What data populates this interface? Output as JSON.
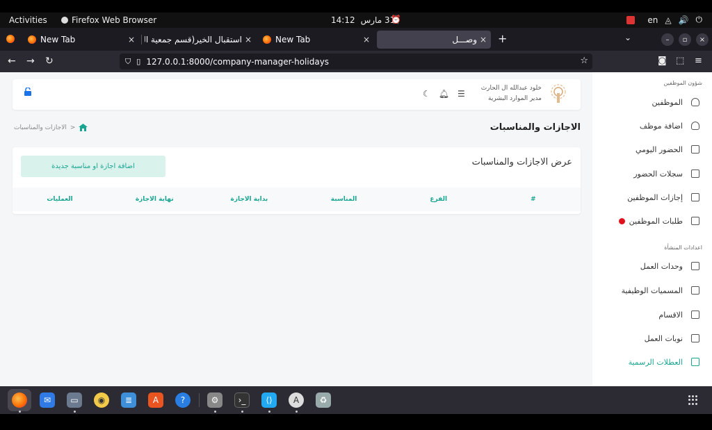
{
  "topbar": {
    "activities": "Activities",
    "app_name": "Firefox Web Browser",
    "time": "14:12",
    "date": "31 مارس",
    "lang": "en"
  },
  "tabs": [
    {
      "title": "New Tab",
      "close": "×"
    },
    {
      "title": "استقبال الخير(قسم جمعية الدع",
      "close": "×"
    },
    {
      "title": "New Tab",
      "close": "×"
    },
    {
      "title": "وصـــل",
      "close": "×"
    }
  ],
  "nav": {
    "url": "127.0.0.1:8000/company-manager-holidays"
  },
  "header": {
    "user_name": "خلود عبدالله ال الحارث",
    "user_role": "مدير الموارد البشرية"
  },
  "sidebar": {
    "section1": "شؤون الموظفين",
    "items1": [
      {
        "label": "الموظفين",
        "icon": "user-icon"
      },
      {
        "label": "اضافة موظف",
        "icon": "user-plus-icon"
      },
      {
        "label": "الحضور اليومي",
        "icon": "calendar-check-icon"
      },
      {
        "label": "سجلات الحضور",
        "icon": "calendar-icon"
      },
      {
        "label": "إجازات الموظفين",
        "icon": "calendar-x-icon"
      },
      {
        "label": "طلبات الموظفين",
        "icon": "calendar-icon"
      }
    ],
    "section2": "اعدادات المنشأة",
    "items2": [
      {
        "label": "وحدات العمل",
        "icon": "building-icon"
      },
      {
        "label": "المسميات الوظيفية",
        "icon": "id-card-icon"
      },
      {
        "label": "الاقسام",
        "icon": "calendar-icon"
      },
      {
        "label": "نوبات العمل",
        "icon": "calendar-icon"
      },
      {
        "label": "العطلات الرسمية",
        "icon": "calendar-icon"
      }
    ],
    "active_color": "#1aa592"
  },
  "page": {
    "title": "الاجازات والمناسبات",
    "breadcrumb": "الاجازات والمناسبات",
    "breadcrumb_sep": ">"
  },
  "card": {
    "title": "عرض الاجازات والمناسبات",
    "add_button": "اضافة اجازة او مناسبة جديدة",
    "columns": [
      "#",
      "الفرع",
      "المناسبة",
      "بداية الاجازة",
      "نهاية الاجازة",
      "العمليات"
    ]
  },
  "colors": {
    "accent": "#1aa592",
    "button_bg": "#d9f2ec",
    "lock_blue": "#1a73e8"
  }
}
